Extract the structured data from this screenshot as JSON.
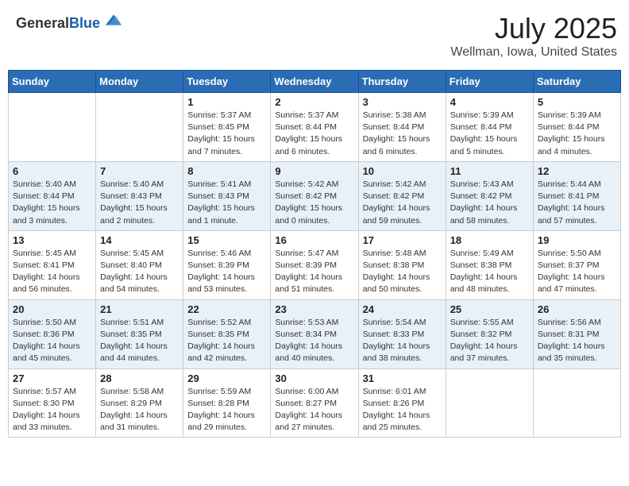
{
  "header": {
    "logo_general": "General",
    "logo_blue": "Blue",
    "title": "July 2025",
    "subtitle": "Wellman, Iowa, United States"
  },
  "calendar": {
    "days_of_week": [
      "Sunday",
      "Monday",
      "Tuesday",
      "Wednesday",
      "Thursday",
      "Friday",
      "Saturday"
    ],
    "weeks": [
      [
        {
          "day": "",
          "info": ""
        },
        {
          "day": "",
          "info": ""
        },
        {
          "day": "1",
          "info": "Sunrise: 5:37 AM\nSunset: 8:45 PM\nDaylight: 15 hours and 7 minutes."
        },
        {
          "day": "2",
          "info": "Sunrise: 5:37 AM\nSunset: 8:44 PM\nDaylight: 15 hours and 6 minutes."
        },
        {
          "day": "3",
          "info": "Sunrise: 5:38 AM\nSunset: 8:44 PM\nDaylight: 15 hours and 6 minutes."
        },
        {
          "day": "4",
          "info": "Sunrise: 5:39 AM\nSunset: 8:44 PM\nDaylight: 15 hours and 5 minutes."
        },
        {
          "day": "5",
          "info": "Sunrise: 5:39 AM\nSunset: 8:44 PM\nDaylight: 15 hours and 4 minutes."
        }
      ],
      [
        {
          "day": "6",
          "info": "Sunrise: 5:40 AM\nSunset: 8:44 PM\nDaylight: 15 hours and 3 minutes."
        },
        {
          "day": "7",
          "info": "Sunrise: 5:40 AM\nSunset: 8:43 PM\nDaylight: 15 hours and 2 minutes."
        },
        {
          "day": "8",
          "info": "Sunrise: 5:41 AM\nSunset: 8:43 PM\nDaylight: 15 hours and 1 minute."
        },
        {
          "day": "9",
          "info": "Sunrise: 5:42 AM\nSunset: 8:42 PM\nDaylight: 15 hours and 0 minutes."
        },
        {
          "day": "10",
          "info": "Sunrise: 5:42 AM\nSunset: 8:42 PM\nDaylight: 14 hours and 59 minutes."
        },
        {
          "day": "11",
          "info": "Sunrise: 5:43 AM\nSunset: 8:42 PM\nDaylight: 14 hours and 58 minutes."
        },
        {
          "day": "12",
          "info": "Sunrise: 5:44 AM\nSunset: 8:41 PM\nDaylight: 14 hours and 57 minutes."
        }
      ],
      [
        {
          "day": "13",
          "info": "Sunrise: 5:45 AM\nSunset: 8:41 PM\nDaylight: 14 hours and 56 minutes."
        },
        {
          "day": "14",
          "info": "Sunrise: 5:45 AM\nSunset: 8:40 PM\nDaylight: 14 hours and 54 minutes."
        },
        {
          "day": "15",
          "info": "Sunrise: 5:46 AM\nSunset: 8:39 PM\nDaylight: 14 hours and 53 minutes."
        },
        {
          "day": "16",
          "info": "Sunrise: 5:47 AM\nSunset: 8:39 PM\nDaylight: 14 hours and 51 minutes."
        },
        {
          "day": "17",
          "info": "Sunrise: 5:48 AM\nSunset: 8:38 PM\nDaylight: 14 hours and 50 minutes."
        },
        {
          "day": "18",
          "info": "Sunrise: 5:49 AM\nSunset: 8:38 PM\nDaylight: 14 hours and 48 minutes."
        },
        {
          "day": "19",
          "info": "Sunrise: 5:50 AM\nSunset: 8:37 PM\nDaylight: 14 hours and 47 minutes."
        }
      ],
      [
        {
          "day": "20",
          "info": "Sunrise: 5:50 AM\nSunset: 8:36 PM\nDaylight: 14 hours and 45 minutes."
        },
        {
          "day": "21",
          "info": "Sunrise: 5:51 AM\nSunset: 8:35 PM\nDaylight: 14 hours and 44 minutes."
        },
        {
          "day": "22",
          "info": "Sunrise: 5:52 AM\nSunset: 8:35 PM\nDaylight: 14 hours and 42 minutes."
        },
        {
          "day": "23",
          "info": "Sunrise: 5:53 AM\nSunset: 8:34 PM\nDaylight: 14 hours and 40 minutes."
        },
        {
          "day": "24",
          "info": "Sunrise: 5:54 AM\nSunset: 8:33 PM\nDaylight: 14 hours and 38 minutes."
        },
        {
          "day": "25",
          "info": "Sunrise: 5:55 AM\nSunset: 8:32 PM\nDaylight: 14 hours and 37 minutes."
        },
        {
          "day": "26",
          "info": "Sunrise: 5:56 AM\nSunset: 8:31 PM\nDaylight: 14 hours and 35 minutes."
        }
      ],
      [
        {
          "day": "27",
          "info": "Sunrise: 5:57 AM\nSunset: 8:30 PM\nDaylight: 14 hours and 33 minutes."
        },
        {
          "day": "28",
          "info": "Sunrise: 5:58 AM\nSunset: 8:29 PM\nDaylight: 14 hours and 31 minutes."
        },
        {
          "day": "29",
          "info": "Sunrise: 5:59 AM\nSunset: 8:28 PM\nDaylight: 14 hours and 29 minutes."
        },
        {
          "day": "30",
          "info": "Sunrise: 6:00 AM\nSunset: 8:27 PM\nDaylight: 14 hours and 27 minutes."
        },
        {
          "day": "31",
          "info": "Sunrise: 6:01 AM\nSunset: 8:26 PM\nDaylight: 14 hours and 25 minutes."
        },
        {
          "day": "",
          "info": ""
        },
        {
          "day": "",
          "info": ""
        }
      ]
    ]
  }
}
